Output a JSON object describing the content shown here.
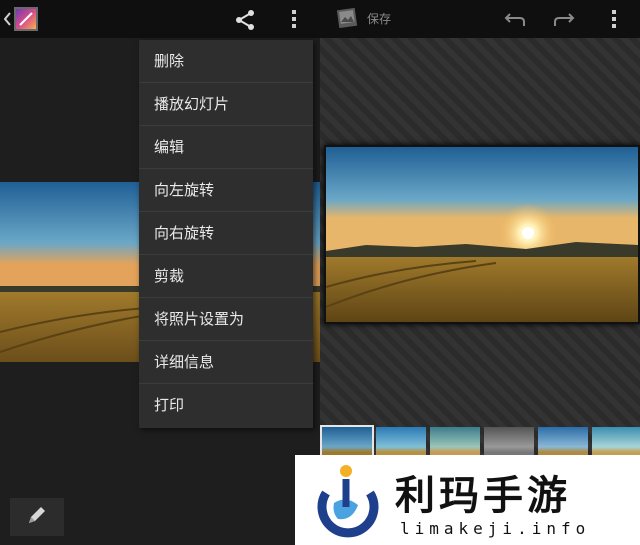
{
  "left_toolbar": {
    "back_icon": "chevron-left-icon",
    "app_icon": "gallery-app-icon",
    "share_icon": "share-icon",
    "overflow_icon": "overflow-menu-icon"
  },
  "menu": {
    "items": [
      {
        "label": "删除"
      },
      {
        "label": "播放幻灯片"
      },
      {
        "label": "编辑"
      },
      {
        "label": "向左旋转"
      },
      {
        "label": "向右旋转"
      },
      {
        "label": "剪裁"
      },
      {
        "label": "将照片设置为"
      },
      {
        "label": "详细信息"
      },
      {
        "label": "打印"
      }
    ]
  },
  "right_toolbar": {
    "save_label": "保存",
    "photo_icon": "photo-icon",
    "undo_icon": "undo-icon",
    "redo_icon": "redo-icon",
    "overflow_icon": "overflow-menu-icon"
  },
  "edit_button": {
    "icon": "pencil-icon"
  },
  "watermark": {
    "title": "利玛手游",
    "subtitle": "limakeji.info"
  },
  "colors": {
    "sky_top": "#1f5f95",
    "sky_horizon": "#e4a35a",
    "field": "#8a6a25",
    "menu_bg": "#2e2e2e"
  }
}
